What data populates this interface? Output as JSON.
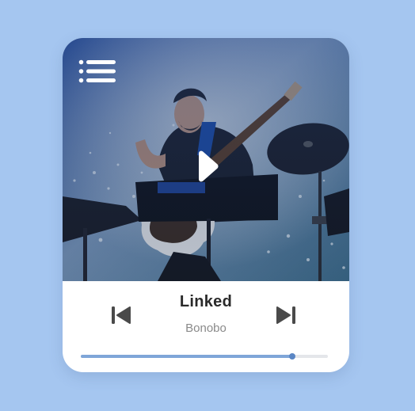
{
  "player": {
    "track_title": "Linked",
    "artist": "Bonobo",
    "progress": 0.855,
    "state": "paused"
  },
  "icons": {
    "menu": "menu-list-icon",
    "play": "play-icon",
    "previous": "skip-previous-icon",
    "next": "skip-next-icon"
  },
  "colors": {
    "background": "#a5c6f0",
    "card": "#ffffff",
    "accent": "#7fa6d8",
    "title": "#2a2a2a",
    "artist": "#8a8a8a",
    "icon": "#4a4a4a"
  }
}
